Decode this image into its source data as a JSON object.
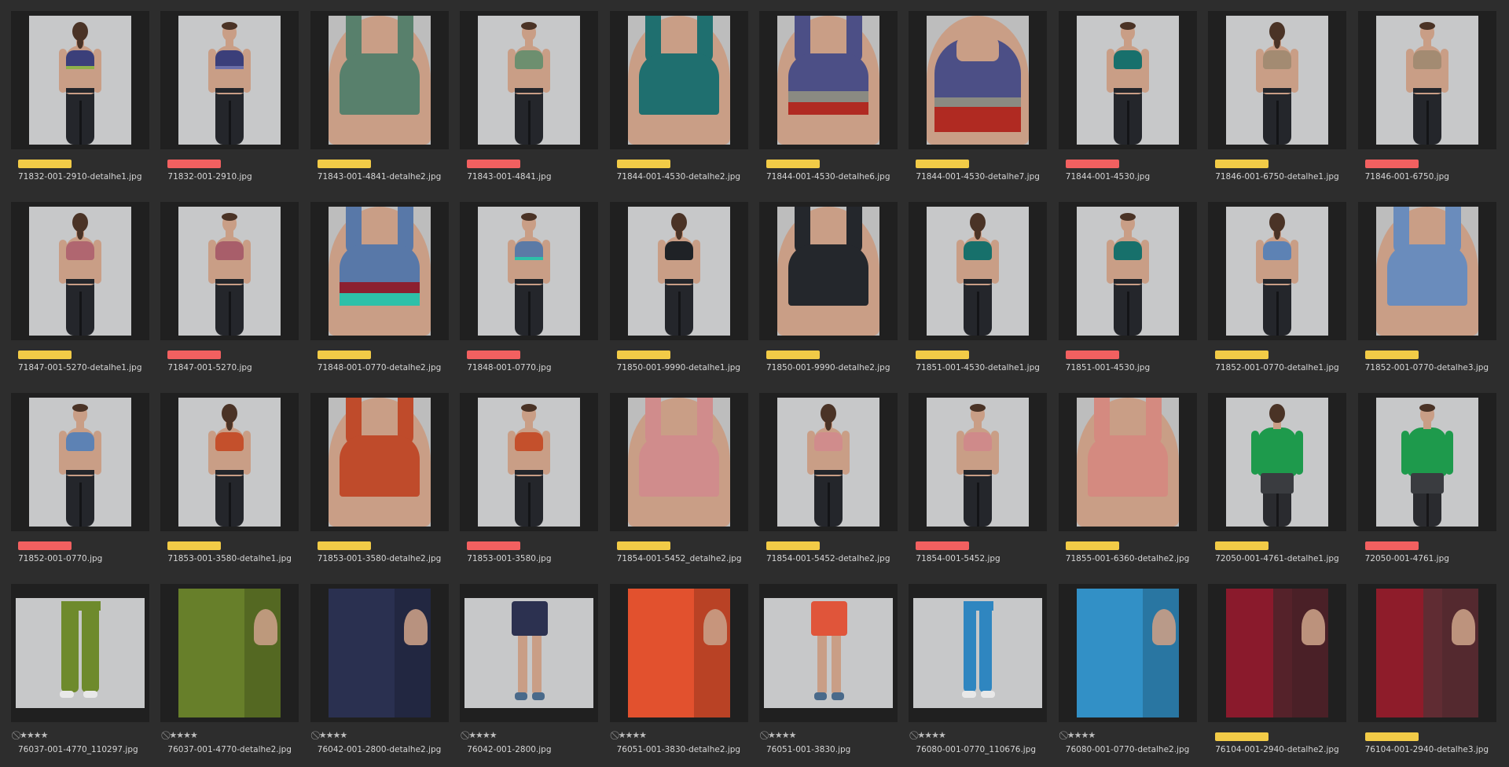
{
  "colors": {
    "background": "#2d2d2d",
    "label_yellow": "#f2cb47",
    "label_red": "#f26060",
    "studio_backdrop": "#c7c8c9",
    "skin": "#c99e86",
    "hair": "#4a3326",
    "leggings": "#24262b"
  },
  "rating_symbols": {
    "no_reject": "⃠",
    "stars": "★★★★"
  },
  "thumbnails": [
    {
      "filename": "71832-001-2910-detalhe1.jpg",
      "label": "yellow",
      "view": "full-back",
      "garment": "#3b3f7a",
      "band": "#8fb04a"
    },
    {
      "filename": "71832-001-2910.jpg",
      "label": "red",
      "view": "full-front",
      "garment": "#3b3f7a",
      "band": "#6c6fa8"
    },
    {
      "filename": "71843-001-4841-detalhe2.jpg",
      "label": "yellow",
      "view": "close-back",
      "garment": "#58806c"
    },
    {
      "filename": "71843-001-4841.jpg",
      "label": "red",
      "view": "full-front",
      "garment": "#6d8f6f"
    },
    {
      "filename": "71844-001-4530-detalhe2.jpg",
      "label": "yellow",
      "view": "close-back",
      "garment": "#1f6f6f"
    },
    {
      "filename": "71844-001-4530-detalhe6.jpg",
      "label": "yellow",
      "view": "close-back",
      "garment": "#4c4f86",
      "band": "#b02a22",
      "band2": "#8a8a82"
    },
    {
      "filename": "71844-001-4530-detalhe7.jpg",
      "label": "yellow",
      "view": "close-front",
      "garment": "#4c4f86",
      "band": "#b02a22",
      "band2": "#8a8a82"
    },
    {
      "filename": "71844-001-4530.jpg",
      "label": "red",
      "view": "full-front",
      "garment": "#18706c"
    },
    {
      "filename": "71846-001-6750-detalhe1.jpg",
      "label": "yellow",
      "view": "full-back",
      "garment": "#a38b72"
    },
    {
      "filename": "71846-001-6750.jpg",
      "label": "red",
      "view": "full-front",
      "garment": "#a38b72"
    },
    {
      "filename": "71847-001-5270-detalhe1.jpg",
      "label": "yellow",
      "view": "full-back",
      "garment": "#b06670"
    },
    {
      "filename": "71847-001-5270.jpg",
      "label": "red",
      "view": "full-front",
      "garment": "#a85e6a"
    },
    {
      "filename": "71848-001-0770-detalhe2.jpg",
      "label": "yellow",
      "view": "close-back",
      "garment": "#5878a8",
      "band": "#2ec0a8",
      "band2": "#8c2030"
    },
    {
      "filename": "71848-001-0770.jpg",
      "label": "red",
      "view": "full-front",
      "garment": "#5b7aa6",
      "band": "#2ec0a8"
    },
    {
      "filename": "71850-001-9990-detalhe1.jpg",
      "label": "yellow",
      "view": "full-back",
      "garment": "#1f2226"
    },
    {
      "filename": "71850-001-9990-detalhe2.jpg",
      "label": "yellow",
      "view": "close-back",
      "garment": "#24272c"
    },
    {
      "filename": "71851-001-4530-detalhe1.jpg",
      "label": "yellow",
      "view": "full-back",
      "garment": "#17706b"
    },
    {
      "filename": "71851-001-4530.jpg",
      "label": "red",
      "view": "full-front",
      "garment": "#17706b"
    },
    {
      "filename": "71852-001-0770-detalhe1.jpg",
      "label": "yellow",
      "view": "full-back",
      "garment": "#5d82b4"
    },
    {
      "filename": "71852-001-0770-detalhe3.jpg",
      "label": "yellow",
      "view": "close-back",
      "garment": "#6a8cbc"
    },
    {
      "filename": "71852-001-0770.jpg",
      "label": "red",
      "view": "full-front",
      "garment": "#5d82b4"
    },
    {
      "filename": "71853-001-3580-detalhe1.jpg",
      "label": "yellow",
      "view": "full-back",
      "garment": "#c4502c"
    },
    {
      "filename": "71853-001-3580-detalhe2.jpg",
      "label": "yellow",
      "view": "close-back",
      "garment": "#bf4b2b"
    },
    {
      "filename": "71853-001-3580.jpg",
      "label": "red",
      "view": "full-front",
      "garment": "#c4502c"
    },
    {
      "filename": "71854-001-5452_detalhe2.jpg",
      "label": "yellow",
      "view": "close-back",
      "garment": "#d08c8c"
    },
    {
      "filename": "71854-001-5452-detalhe2.jpg",
      "label": "yellow",
      "view": "full-back",
      "garment": "#d08c8c"
    },
    {
      "filename": "71854-001-5452.jpg",
      "label": "red",
      "view": "full-front",
      "garment": "#cf8a8a"
    },
    {
      "filename": "71855-001-6360-detalhe2.jpg",
      "label": "yellow",
      "view": "close-back",
      "garment": "#d48a80"
    },
    {
      "filename": "72050-001-4761-detalhe1.jpg",
      "label": "yellow",
      "view": "man-back",
      "garment": "#1e9a4c"
    },
    {
      "filename": "72050-001-4761.jpg",
      "label": "red",
      "view": "man-front",
      "garment": "#1e9a4c"
    },
    {
      "filename": "76037-001-4770_110297.jpg",
      "label": "rating",
      "view": "pants-wide",
      "garment": "#6e8a2c"
    },
    {
      "filename": "76037-001-4770-detalhe2.jpg",
      "label": "rating",
      "view": "close-fabric",
      "garment": "#677f2a"
    },
    {
      "filename": "76042-001-2800-detalhe2.jpg",
      "label": "rating",
      "view": "close-fabric",
      "garment": "#2a3050"
    },
    {
      "filename": "76042-001-2800.jpg",
      "label": "rating",
      "view": "shorts",
      "garment": "#2c3150"
    },
    {
      "filename": "76051-001-3830-detalhe2.jpg",
      "label": "rating",
      "view": "close-fabric",
      "garment": "#e2512e"
    },
    {
      "filename": "76051-001-3830.jpg",
      "label": "rating",
      "view": "shorts",
      "garment": "#e0553a"
    },
    {
      "filename": "76080-001-0770_110676.jpg",
      "label": "rating",
      "view": "pants-slim",
      "garment": "#2f86c0"
    },
    {
      "filename": "76080-001-0770-detalhe2.jpg",
      "label": "rating",
      "view": "close-fabric",
      "garment": "#3290c6"
    },
    {
      "filename": "76104-001-2940-detalhe2.jpg",
      "label": "yellow",
      "view": "close-fabric",
      "garment": "#8a1a2c",
      "band": "#2a2a2a"
    },
    {
      "filename": "76104-001-2940-detalhe3.jpg",
      "label": "yellow",
      "view": "close-fabric",
      "garment": "#8e1c2a",
      "band": "#3a3a3a"
    }
  ]
}
